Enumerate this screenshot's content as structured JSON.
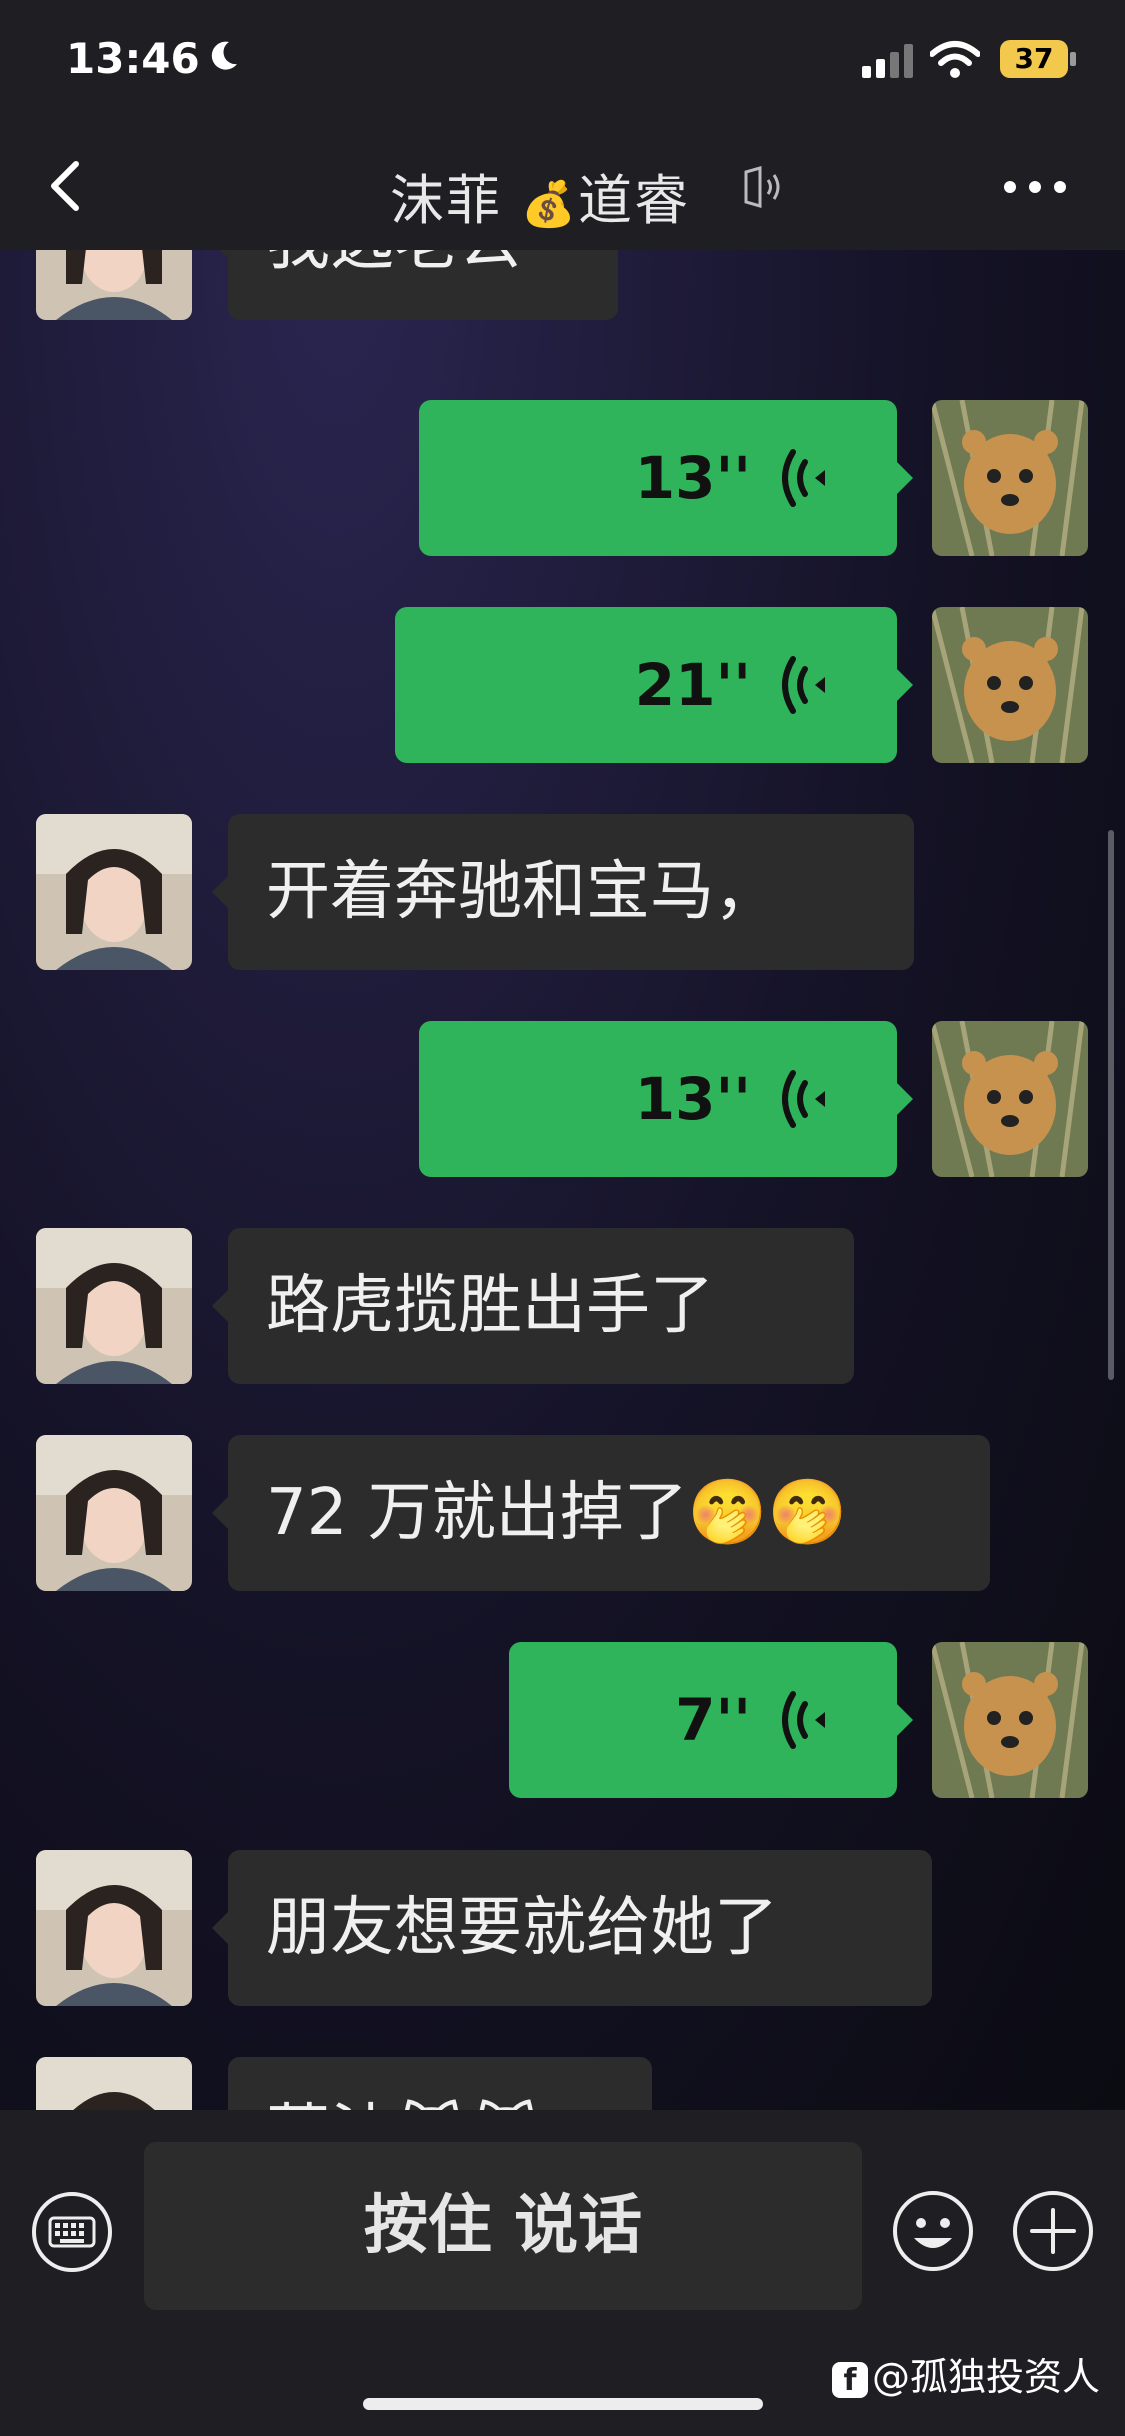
{
  "status_bar": {
    "time": "13:46",
    "battery": "37"
  },
  "nav": {
    "title": "沫菲",
    "title_emoji": "💰",
    "title_suffix": "道睿"
  },
  "messages": [
    {
      "side": "in",
      "text": "我选老公"
    },
    {
      "side": "out",
      "duration": "13''"
    },
    {
      "side": "out",
      "duration": "21''"
    },
    {
      "side": "in",
      "text": "开着奔驰和宝马，"
    },
    {
      "side": "out",
      "duration": "13''"
    },
    {
      "side": "in",
      "text": "路虎揽胜出手了"
    },
    {
      "side": "in",
      "text": "72 万就出掉了🤭🤭"
    },
    {
      "side": "out",
      "duration": "7''"
    },
    {
      "side": "in",
      "text": "朋友想要就给她了"
    },
    {
      "side": "in",
      "text": "莫法😹😹"
    }
  ],
  "input_bar": {
    "talk_label": "按住 说话"
  },
  "watermark": {
    "text": "@孤独投资人"
  },
  "colors": {
    "bubble_out": "#2fb45b",
    "bubble_in": "#2c2c2c",
    "bar": "#1f1f23"
  }
}
